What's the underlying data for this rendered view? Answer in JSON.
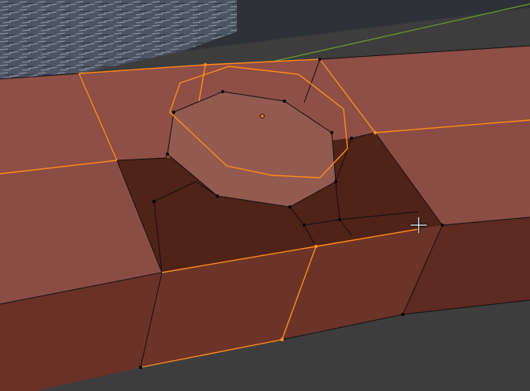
{
  "app": {
    "view": "3d-viewport",
    "mode": "edit-mode",
    "selection_type": "edge-loop"
  },
  "colors": {
    "viewport_background": "#3d3d3d",
    "wall_top": "#8f5048",
    "wall_front": "#6a3226",
    "pit_floor": "#4f2318",
    "cylinder_top": "#935a50",
    "selection_orange": "#ff8c1a",
    "edge_black": "#111111",
    "x_axis_green": "#6b9e2a",
    "texture_backdrop": "#4e5766"
  },
  "icons": {
    "cursor": "crosshair-cursor-icon",
    "origin": "object-origin-dot-icon"
  }
}
